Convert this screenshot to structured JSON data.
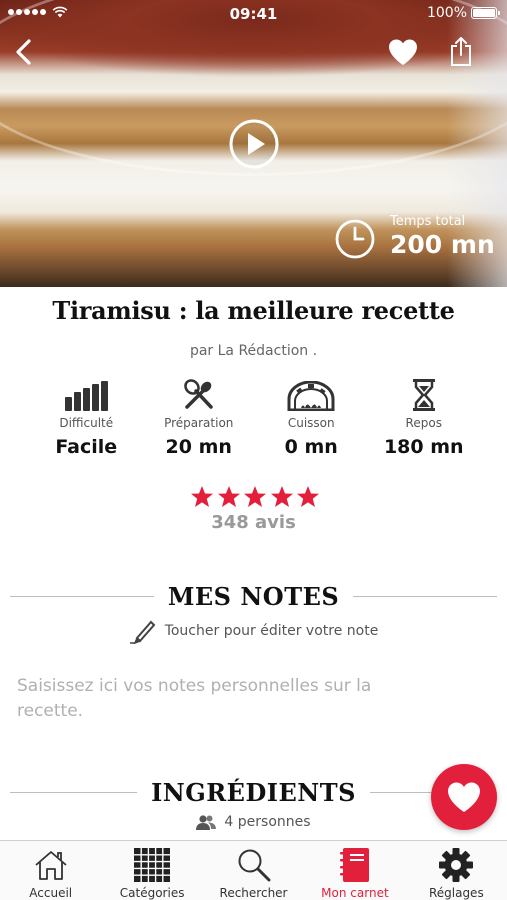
{
  "status_bar": {
    "time": "09:41",
    "battery": "100%"
  },
  "hero": {
    "total_time_label": "Temps total",
    "total_time_value": "200 mn"
  },
  "recipe": {
    "title": "Tiramisu : la meilleure recette",
    "author": "par La Rédaction ."
  },
  "stats": [
    {
      "icon": "difficulty-bars-icon",
      "label": "Difficulté",
      "value": "Facile"
    },
    {
      "icon": "whisk-spoon-icon",
      "label": "Préparation",
      "value": "20 mn"
    },
    {
      "icon": "oven-icon",
      "label": "Cuisson",
      "value": "0 mn"
    },
    {
      "icon": "hourglass-icon",
      "label": "Repos",
      "value": "180 mn"
    }
  ],
  "rating": {
    "stars": 5,
    "max_stars": 5,
    "reviews": "348 avis"
  },
  "notes": {
    "title": "MES NOTES",
    "edit_hint": "Toucher pour éditer votre note",
    "placeholder": "Saisissez ici vos notes personnelles sur la recette."
  },
  "ingredients": {
    "title": "INGRÉDIENTS",
    "persons": "4 personnes"
  },
  "tabbar": {
    "items": [
      {
        "label": "Accueil",
        "icon": "home-icon"
      },
      {
        "label": "Catégories",
        "icon": "grid-icon"
      },
      {
        "label": "Rechercher",
        "icon": "search-icon"
      },
      {
        "label": "Mon carnet",
        "icon": "notebook-icon",
        "active": true
      },
      {
        "label": "Réglages",
        "icon": "gear-icon"
      }
    ]
  },
  "colors": {
    "accent": "#e3203c",
    "text": "#111111",
    "muted": "#999999"
  }
}
